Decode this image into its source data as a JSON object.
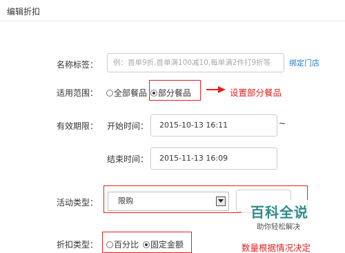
{
  "header": {
    "title": "编辑折扣"
  },
  "form": {
    "name_label": "名称标签：",
    "name_placeholder": "例：首单9折,首单满100减10,每单满2件打9折等",
    "bind_store_link": "绑定门店",
    "scope_label": "适用范围：",
    "scope_options": [
      {
        "label": "全部餐品",
        "checked": false
      },
      {
        "label": "部分餐品",
        "checked": true
      }
    ],
    "scope_annotation": "设置部分餐品",
    "validity_label": "有效期限：",
    "start_label": "开始时间：",
    "start_value": "2015-10-13 16:11",
    "range_sep": "~",
    "end_label": "结束时间：",
    "end_value": "2015-11-13 16:09",
    "activity_label": "活动类型：",
    "activity_selected": "限购",
    "discount_label": "折扣类型：",
    "discount_options": [
      {
        "label": "百分比",
        "checked": false
      },
      {
        "label": "固定金额",
        "checked": true
      }
    ],
    "bottom_annotation": "数量根据情况决定"
  },
  "watermark": {
    "title": "百科全说",
    "subtitle": "助你轻松解决"
  },
  "colors": {
    "annotation_red": "#e02020",
    "link_blue": "#1f7bd1",
    "watermark_teal": "#2e8b8b"
  }
}
